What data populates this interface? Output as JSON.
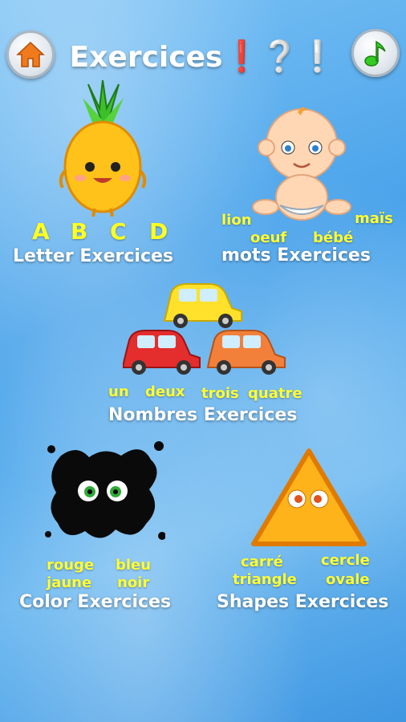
{
  "header": {
    "title": "Exercices",
    "title_marks": "❗❔❕",
    "home_icon": "home-icon",
    "music_icon": "music-note-icon"
  },
  "letters": {
    "items": [
      "A",
      "B",
      "C",
      "D"
    ],
    "label": "Letter Exercices"
  },
  "words": {
    "items": [
      "lion",
      "oeuf",
      "bébé",
      "maïs"
    ],
    "label": "mots Exercices"
  },
  "numbers": {
    "items": [
      "un",
      "deux",
      "trois",
      "quatre"
    ],
    "label": "Nombres Exercices"
  },
  "colors": {
    "items": [
      "rouge",
      "bleu",
      "jaune",
      "noir"
    ],
    "label": "Color Exercices"
  },
  "shapes": {
    "items": [
      "carré",
      "cercle",
      "triangle",
      "ovale"
    ],
    "label": "Shapes Exercices"
  },
  "theme": {
    "accent_orange": "#f07a1c",
    "word_yellow": "#ffff33",
    "music_green": "#33cc22"
  }
}
